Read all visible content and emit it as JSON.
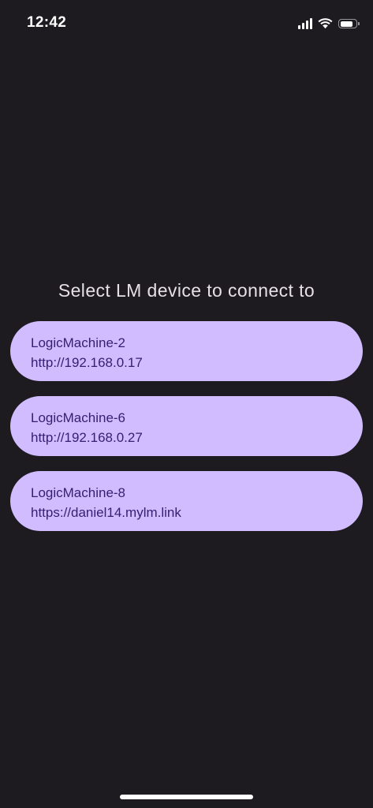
{
  "status_bar": {
    "time": "12:42",
    "battery_level": 0.85,
    "icons": [
      "cellular-signal-icon",
      "wifi-icon",
      "battery-icon"
    ]
  },
  "main": {
    "title": "Select LM device to connect to",
    "devices": [
      {
        "name": "LogicMachine-2",
        "url": "http://192.168.0.17"
      },
      {
        "name": "LogicMachine-6",
        "url": "http://192.168.0.27"
      },
      {
        "name": "LogicMachine-8",
        "url": "https://daniel14.mylm.link"
      }
    ]
  },
  "colors": {
    "background": "#1d1b20",
    "button_background": "#d0bcff",
    "button_text": "#381e72",
    "title_text": "#e6e0e9"
  }
}
